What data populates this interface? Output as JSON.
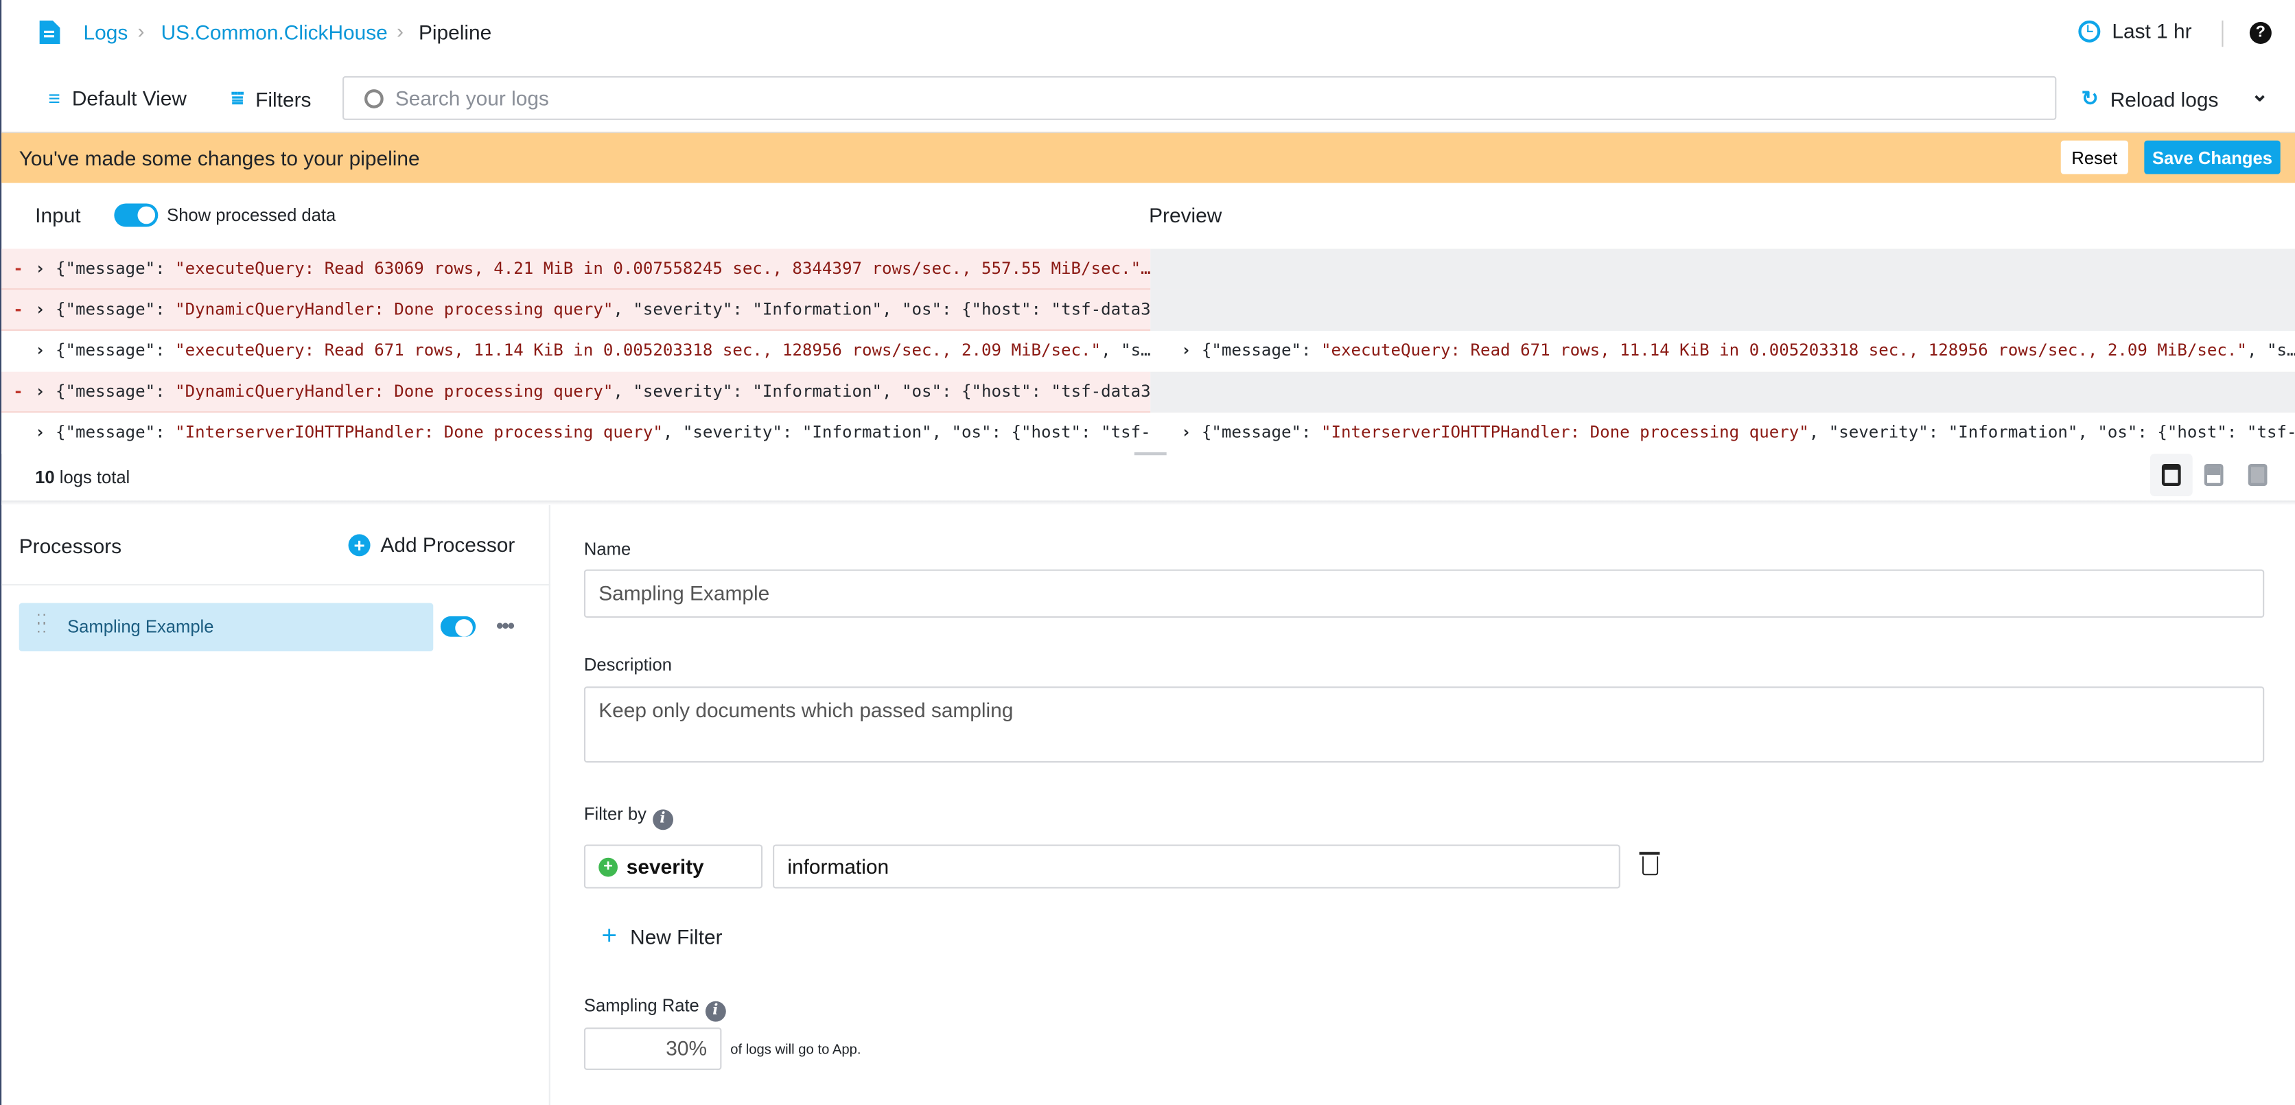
{
  "breadcrumb": [
    "Logs",
    "US.Common.ClickHouse",
    "Pipeline"
  ],
  "header": {
    "time_range": "Last 1 hr",
    "help": "?"
  },
  "toolbar": {
    "default_view": "Default View",
    "filters": "Filters",
    "search_placeholder": "Search your logs",
    "reload": "Reload logs"
  },
  "banner": {
    "message": "You've made some changes to your pipeline",
    "reset": "Reset",
    "save": "Save Changes",
    "color": "#fecf8a"
  },
  "panel": {
    "input_label": "Input",
    "show_processed": "Show processed data",
    "show_processed_on": true,
    "preview_label": "Preview"
  },
  "logs": [
    {
      "status": "removed",
      "input": {
        "prefix": "{\"message\": ",
        "msg": "\"executeQuery: Read 63069 rows, 4.21 MiB in 0.007558245 sec., 8344397 rows/sec., 557.55 MiB/sec.\"…",
        "rest": ""
      },
      "preview": null
    },
    {
      "status": "removed",
      "input": {
        "prefix": "{\"message\": ",
        "msg": "\"DynamicQueryHandler: Done processing query\"",
        "rest": ", \"severity\": \"Information\", \"os\": {\"host\": \"tsf-data3…"
      },
      "preview": null
    },
    {
      "status": "kept",
      "input": {
        "prefix": "{\"message\": ",
        "msg": "\"executeQuery: Read 671 rows, 11.14 KiB in 0.005203318 sec., 128956 rows/sec., 2.09 MiB/sec.\"",
        "rest": ", \"s…"
      },
      "preview": {
        "prefix": "{\"message\": ",
        "msg": "\"executeQuery: Read 671 rows, 11.14 KiB in 0.005203318 sec., 128956 rows/sec., 2.09 MiB/sec.\"",
        "rest": ", \"s…"
      }
    },
    {
      "status": "removed",
      "input": {
        "prefix": "{\"message\": ",
        "msg": "\"DynamicQueryHandler: Done processing query\"",
        "rest": ", \"severity\": \"Information\", \"os\": {\"host\": \"tsf-data3…"
      },
      "preview": null
    },
    {
      "status": "kept",
      "input": {
        "prefix": "{\"message\": ",
        "msg": "\"InterserverIOHTTPHandler: Done processing query\"",
        "rest": ", \"severity\": \"Information\", \"os\": {\"host\": \"tsf-…"
      },
      "preview": {
        "prefix": "{\"message\": ",
        "msg": "\"InterserverIOHTTPHandler: Done processing query\"",
        "rest": ", \"severity\": \"Information\", \"os\": {\"host\": \"tsf-…"
      }
    }
  ],
  "footer": {
    "count": "10",
    "count_suffix": "logs total"
  },
  "processors": {
    "title": "Processors",
    "add": "Add Processor",
    "items": [
      {
        "name": "Sampling Example",
        "enabled": true
      }
    ]
  },
  "form": {
    "name_label": "Name",
    "name_value": "Sampling Example",
    "description_label": "Description",
    "description_value": "Keep only documents which passed sampling",
    "filter_label": "Filter by",
    "filter_field": "severity",
    "filter_value": "information",
    "new_filter": "New Filter",
    "sampling_label": "Sampling Rate",
    "sampling_value": "30%",
    "sampling_suffix": "of logs will go to App."
  },
  "colors": {
    "accent": "#0ea5e9",
    "removed_row": "#fcecec",
    "string": "#8b1a14"
  }
}
